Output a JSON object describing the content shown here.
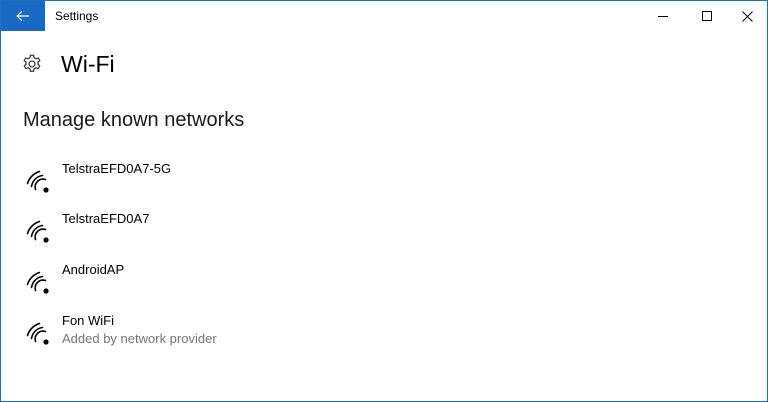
{
  "window": {
    "title": "Settings",
    "accent_color": "#1769c4"
  },
  "titlebar": {
    "back_icon": "arrow-left-icon",
    "minimize_icon": "minimize-icon",
    "maximize_icon": "maximize-icon",
    "close_icon": "close-icon"
  },
  "header": {
    "icon": "gear-icon",
    "title": "Wi-Fi"
  },
  "section": {
    "title": "Manage known networks"
  },
  "networks": [
    {
      "name": "TelstraEFD0A7-5G",
      "subtitle": "",
      "icon": "wifi-icon"
    },
    {
      "name": "TelstraEFD0A7",
      "subtitle": "",
      "icon": "wifi-icon"
    },
    {
      "name": "AndroidAP",
      "subtitle": "",
      "icon": "wifi-icon"
    },
    {
      "name": "Fon WiFi",
      "subtitle": "Added by network provider",
      "icon": "wifi-icon"
    }
  ]
}
